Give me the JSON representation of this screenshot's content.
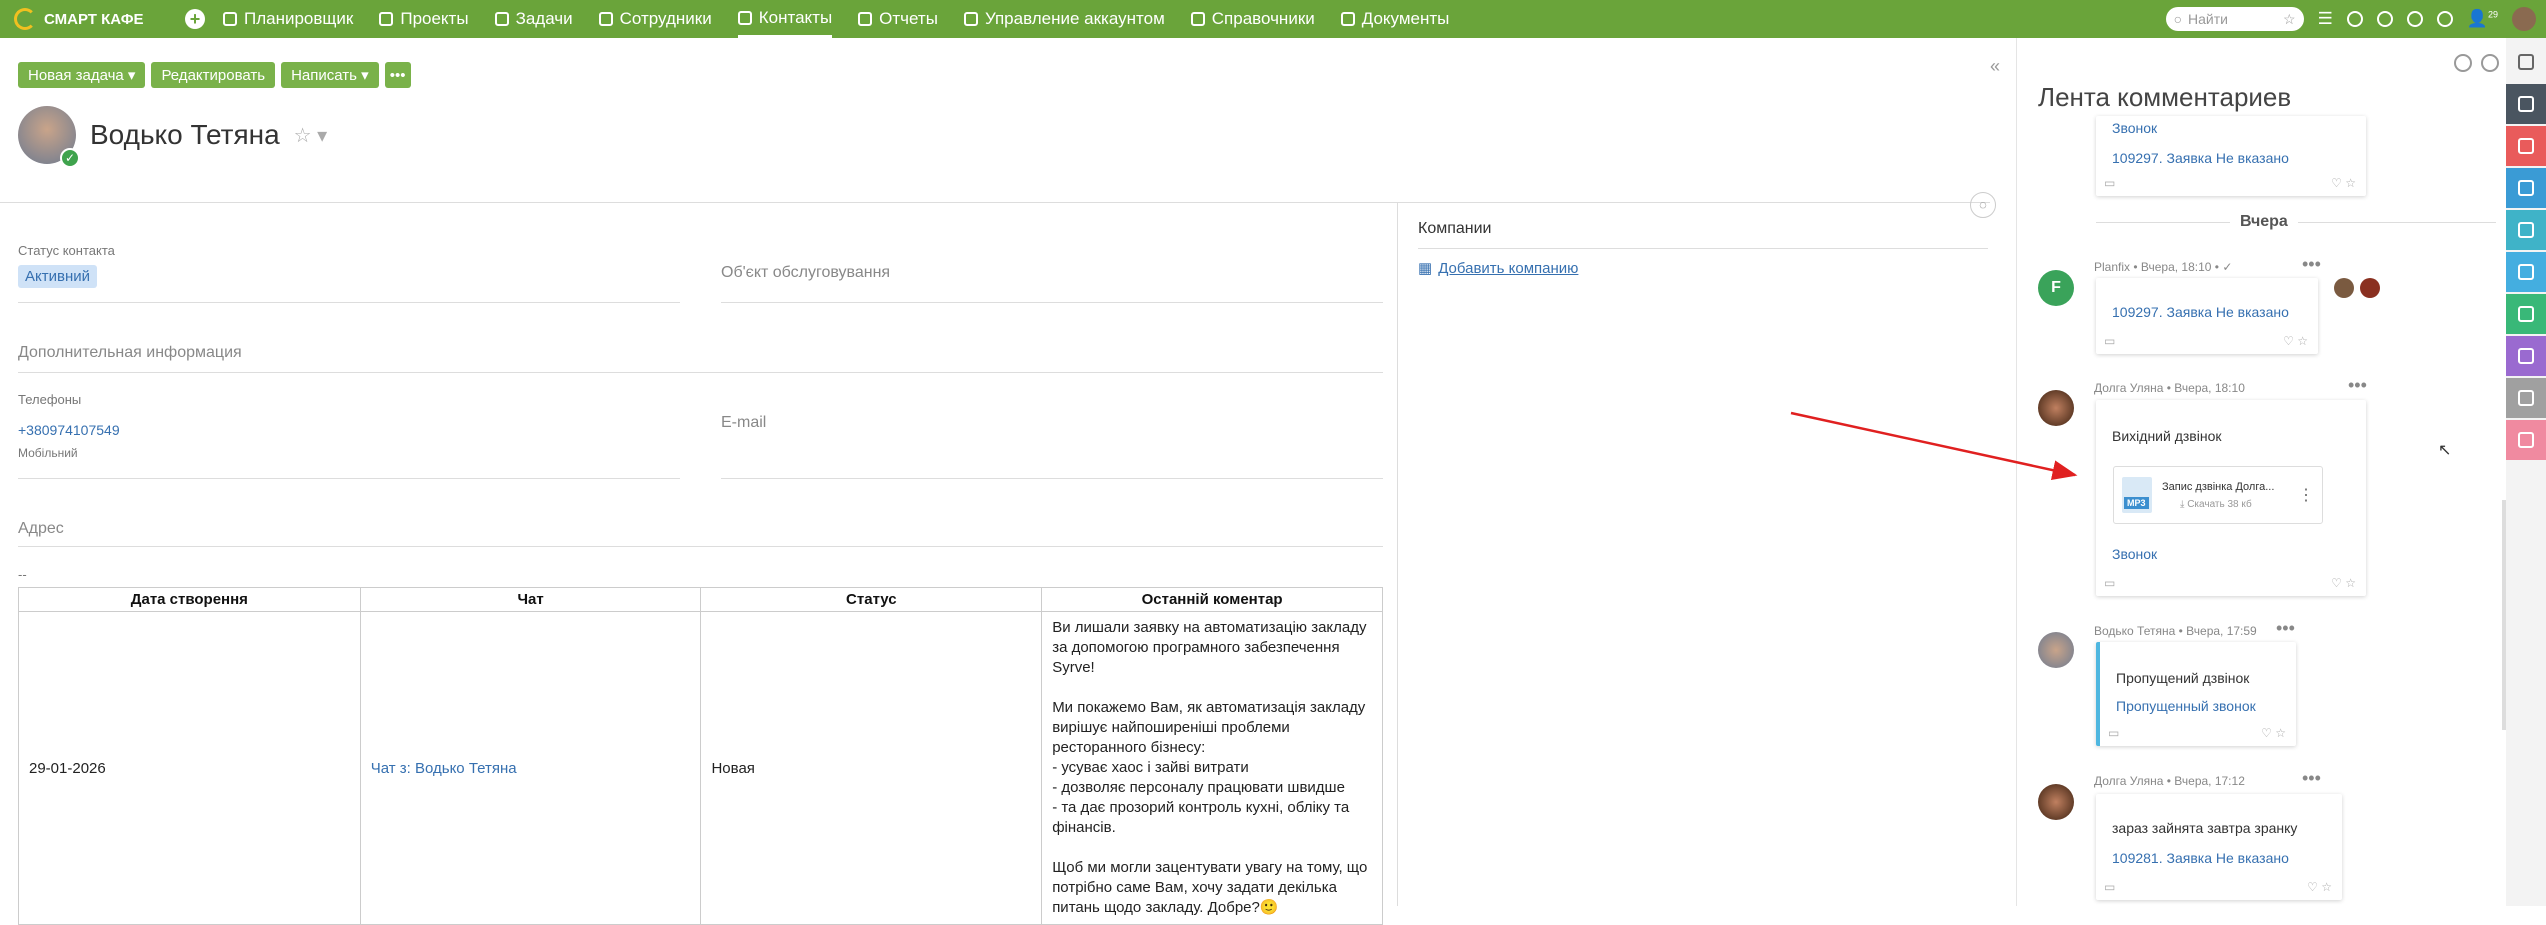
{
  "app": {
    "logo_text": "СМАРТ КАФЕ"
  },
  "nav": [
    {
      "label": "Планировщик",
      "active": false
    },
    {
      "label": "Проекты",
      "active": false
    },
    {
      "label": "Задачи",
      "active": false
    },
    {
      "label": "Сотрудники",
      "active": false
    },
    {
      "label": "Контакты",
      "active": true
    },
    {
      "label": "Отчеты",
      "active": false
    },
    {
      "label": "Управление аккаунтом",
      "active": false
    },
    {
      "label": "Справочники",
      "active": false
    },
    {
      "label": "Документы",
      "active": false
    }
  ],
  "search": {
    "placeholder": "Найти"
  },
  "notifications": {
    "count": "29"
  },
  "toolbar": {
    "new_task": "Новая задача ▾",
    "edit": "Редактировать",
    "write": "Написать ▾",
    "more": "•••"
  },
  "contact": {
    "name": "Водько Тетяна",
    "status_label": "Статус контакта",
    "status_value": "Активний",
    "service_object_label": "Об'єкт обслуговування",
    "additional_info_label": "Дополнительная информация",
    "phones_label": "Телефоны",
    "phone": "+380974107549",
    "phone_type": "Мобільний",
    "email_label": "E-mail",
    "address_label": "Адрес",
    "address_value": "--"
  },
  "companies": {
    "title": "Компании",
    "add_label": "Добавить компанию"
  },
  "table": {
    "headers": [
      "Дата створення",
      "Чат",
      "Статус",
      "Останній коментар"
    ],
    "rows": [
      {
        "date": "29-01-2026",
        "chat": "Чат з: Водько Тетяна",
        "status": "Новая",
        "comment": "Ви лишали заявку на автоматизацію закладу за допомогою програмного забезпечення Syrve!\n\nМи покажемо Вам, як автоматизація закладу вирішує найпоширеніші проблеми ресторанного бізнесу:\n- усуває хаос і зайві витрати\n- дозволяє персоналу працювати швидше\n- та дає прозорий контроль кухні, обліку та фінансів.\n\nЩоб ми могли зацентувати увагу на тому, що потрібно саме Вам, хочу задати декілька питань щодо закладу. Добре?🙂"
      }
    ]
  },
  "feed": {
    "title": "Лента комментариев",
    "yesterday": "Вчера",
    "top_card": {
      "link_top": "Звонок",
      "task_link": "109297. Заявка Не вказано"
    },
    "items": [
      {
        "meta": "Planfix • Вчера, 18:10 • ✓",
        "task_link": "109297. Заявка Не вказано"
      },
      {
        "meta": "Долга Уляна • Вчера, 18:10",
        "text": "Вихідний дзвінок",
        "file_name": "Запис дзвінка Долга...",
        "file_action": "Скачать",
        "file_size": "38 кб",
        "file_type": "MP3",
        "link": "Звонок"
      },
      {
        "meta": "Водько Тетяна • Вчера, 17:59",
        "text": "Пропущений дзвінок",
        "link": "Пропущенный звонок"
      },
      {
        "meta": "Долга Уляна • Вчера, 17:12",
        "text": "зараз зайнята завтра зранку",
        "task_link": "109281. Заявка Не вказано"
      }
    ]
  },
  "colors": {
    "brand": "#6aa43a",
    "link": "#3670b0",
    "sidebar": [
      "#4a5560",
      "#e95b5b",
      "#3a9bd5",
      "#3fb3c8",
      "#44aee0",
      "#39b878",
      "#9a6ad0",
      "#a0a0a0",
      "#f08aa0"
    ]
  }
}
